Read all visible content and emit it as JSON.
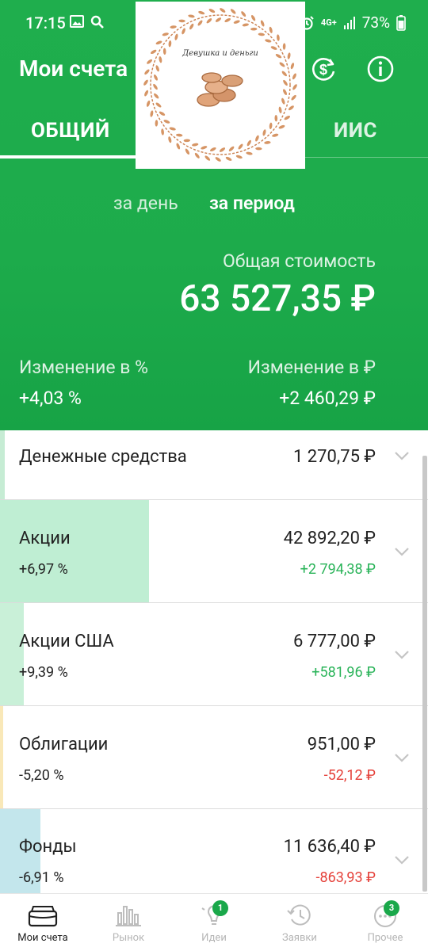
{
  "status_bar": {
    "time": "17:15",
    "network": "4G+",
    "battery": "73%"
  },
  "header": {
    "title": "Мои счета",
    "tabs": [
      {
        "label": "ОБЩИЙ"
      },
      {
        "label": "ИИС"
      }
    ],
    "period": {
      "day": "за день",
      "period": "за период"
    }
  },
  "logo": {
    "text": "Девушка и деньги"
  },
  "summary": {
    "total_label": "Общая стоимость",
    "total_value": "63 527,35 ₽",
    "change_pct_label": "Изменение в  %",
    "change_pct_value": "+4,03  %",
    "change_rub_label": "Изменение в ₽",
    "change_rub_value": "+2 460,29 ₽"
  },
  "assets": [
    {
      "name": "Денежные средства",
      "amount": "1 270,75 ₽",
      "share": 0.012,
      "color": "#c6ecd4"
    },
    {
      "name": "Акции",
      "pct": "+6,97  %",
      "amount": "42 892,20 ₽",
      "delta": "+2 794,38 ₽",
      "trend": "pos",
      "share": 0.348,
      "color": "#bfeed3"
    },
    {
      "name": "Акции США",
      "pct": "+9,39  %",
      "amount": "6 777,00 ₽",
      "delta": "+581,96 ₽",
      "trend": "pos",
      "share": 0.055,
      "color": "#c9f0d8"
    },
    {
      "name": "Облигации",
      "pct": "-5,20  %",
      "amount": "951,00 ₽",
      "delta": "-52,12 ₽",
      "trend": "neg",
      "share": 0.008,
      "color": "#f9e8b8"
    },
    {
      "name": "Фонды",
      "pct": "-6,91  %",
      "amount": "11 636,40 ₽",
      "delta": "-863,93 ₽",
      "trend": "neg",
      "share": 0.094,
      "color": "#c3e6ec"
    }
  ],
  "bottom_nav": [
    {
      "label": "Мои счета",
      "icon": "wallet-icon",
      "active": true
    },
    {
      "label": "Рынок",
      "icon": "market-chart-icon"
    },
    {
      "label": "Идеи",
      "icon": "lightbulb-icon",
      "badge": "1"
    },
    {
      "label": "Заявки",
      "icon": "history-clock-icon"
    },
    {
      "label": "Прочее",
      "icon": "more-dots-icon",
      "badge": "3"
    }
  ],
  "colors": {
    "primary": "#1dab4b",
    "positive": "#2bb45a",
    "negative": "#e5413a",
    "logo_wreath": "#d08a5a"
  }
}
